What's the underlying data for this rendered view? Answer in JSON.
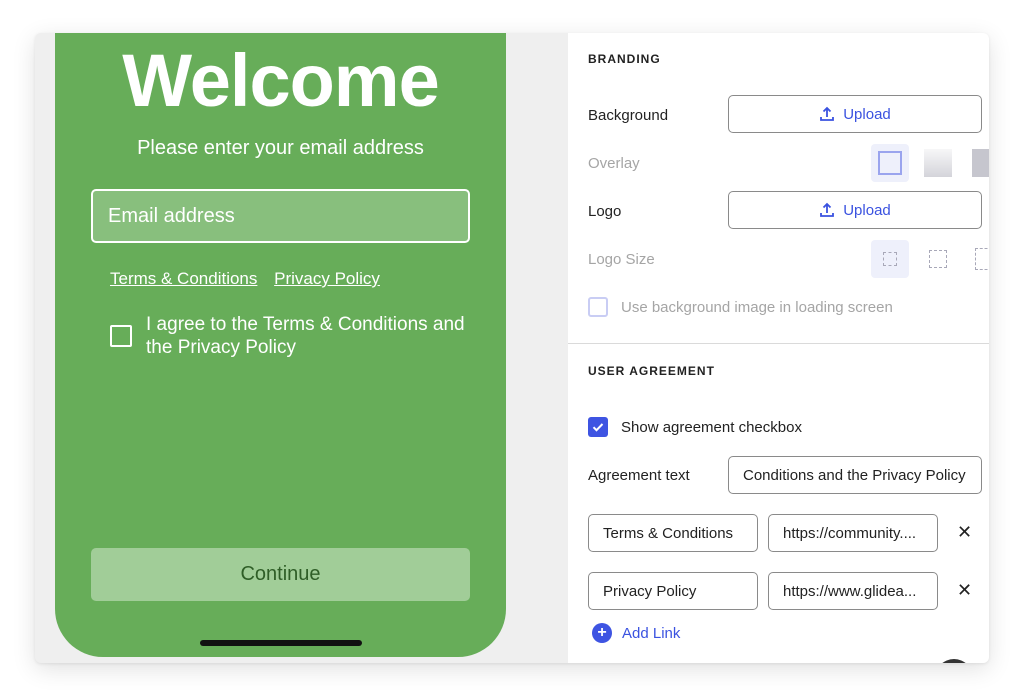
{
  "preview": {
    "title": "Welcome",
    "subtitle": "Please enter your email address",
    "email_placeholder": "Email address",
    "links": [
      "Terms & Conditions",
      "Privacy Policy"
    ],
    "agreement": "I agree to the Terms & Conditions and the Privacy Policy",
    "continue_label": "Continue",
    "theme_color": "#67ad59"
  },
  "branding": {
    "section_title": "BRANDING",
    "background_label": "Background",
    "upload_label": "Upload",
    "overlay_label": "Overlay",
    "logo_label": "Logo",
    "logo_size_label": "Logo Size",
    "loading_checkbox_label": "Use background image in loading screen"
  },
  "user_agreement": {
    "section_title": "USER AGREEMENT",
    "show_checkbox_label": "Show agreement checkbox",
    "agreement_text_label": "Agreement text",
    "agreement_text_value": "Conditions and the Privacy Policy",
    "links": [
      {
        "title": "Terms & Conditions",
        "url": "https://community...."
      },
      {
        "title": "Privacy Policy",
        "url": "https://www.glidea..."
      }
    ],
    "add_link_label": "Add Link"
  },
  "colors": {
    "accent": "#3e54e2",
    "preview_green": "#67ad59"
  }
}
